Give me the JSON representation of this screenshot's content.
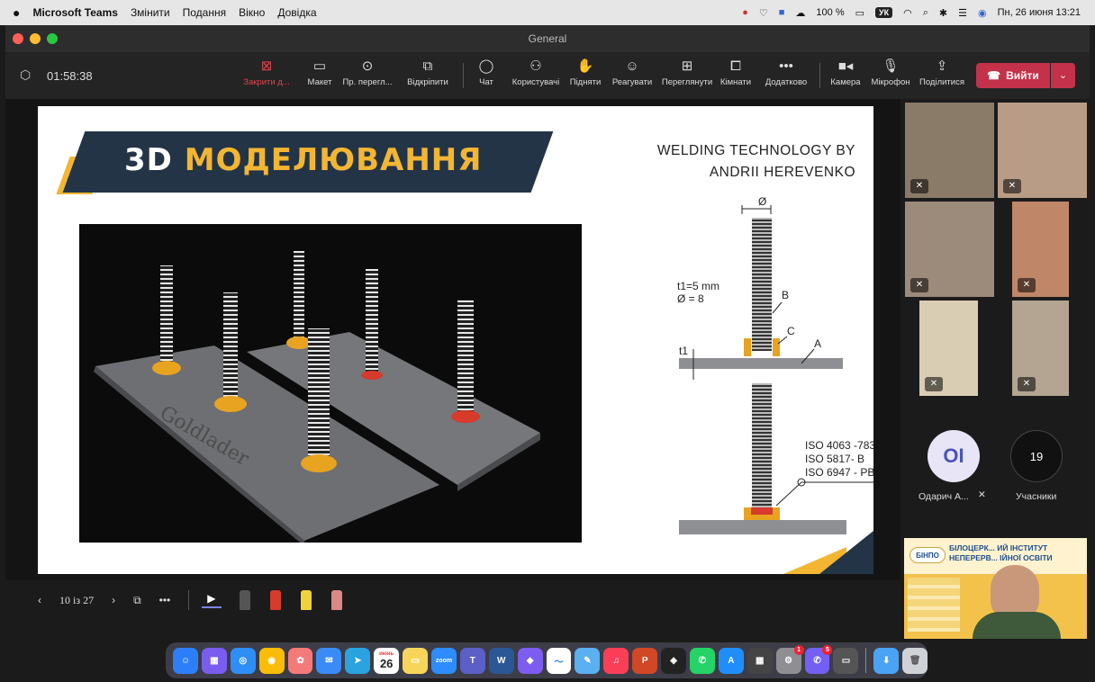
{
  "menubar": {
    "app": "Microsoft Teams",
    "menus": [
      "Змінити",
      "Подання",
      "Вікно",
      "Довідка"
    ],
    "battery": "100 %",
    "keyboard": "УК",
    "datetime": "Пн, 26 июня  13:21"
  },
  "window": {
    "title": "General"
  },
  "toolbar": {
    "timer": "01:58:38",
    "buttons": [
      {
        "label": "Закрити д...",
        "icon": "close-share-icon"
      },
      {
        "label": "Макет",
        "icon": "layout-icon"
      },
      {
        "label": "Пр. перегл...",
        "icon": "eye-icon"
      },
      {
        "label": "Відкріпити",
        "icon": "popout-icon"
      },
      {
        "label": "Чат",
        "icon": "chat-icon"
      },
      {
        "label": "Користувачі",
        "icon": "people-icon"
      },
      {
        "label": "Підняти",
        "icon": "raise-hand-icon"
      },
      {
        "label": "Реагувати",
        "icon": "smile-icon"
      },
      {
        "label": "Переглянути",
        "icon": "view-icon"
      },
      {
        "label": "Кімнати",
        "icon": "rooms-icon"
      },
      {
        "label": "Додатково",
        "icon": "more-icon"
      },
      {
        "label": "Камера",
        "icon": "camera-icon"
      },
      {
        "label": "Мікрофон",
        "icon": "mic-icon"
      },
      {
        "label": "Поділитися",
        "icon": "share-icon"
      }
    ],
    "leave_label": "Вийти",
    "accent": "#c4314b"
  },
  "slide": {
    "banner_prefix": "3D",
    "banner_main": "МОДЕЛЮВАННЯ",
    "welding_line1": "WELDING TECHNOLOGY BY",
    "welding_line2": "ANDRII HEREVENKO",
    "dim_diameter": "Ø",
    "dim_t1_mm": "t1=5 mm",
    "dim_d8": "Ø = 8",
    "label_b": "B",
    "label_c": "C",
    "label_a": "A",
    "label_t1": "t1",
    "iso1": "ISO 4063 -783",
    "iso2": "ISO 5817- B",
    "iso3": "ISO 6947 - PB",
    "plate_text": "Goldlader"
  },
  "slide_nav": {
    "counter": "10 із 27"
  },
  "participants": {
    "avatar_initials": "OI",
    "avatar_name": "Одарич А...",
    "count": "19",
    "count_label": "Учасники"
  },
  "self_view": {
    "title_line1": "БІЛОЦЕРК... ИЙ ІНСТИТУТ",
    "title_line2": "НЕПЕРЕРВ... ІЙНОЇ ОСВІТИ",
    "logo": "БІНПО"
  },
  "dock": {
    "calendar_month": "июнь",
    "calendar_day": "26",
    "badge1": "1",
    "badge2": "5"
  }
}
